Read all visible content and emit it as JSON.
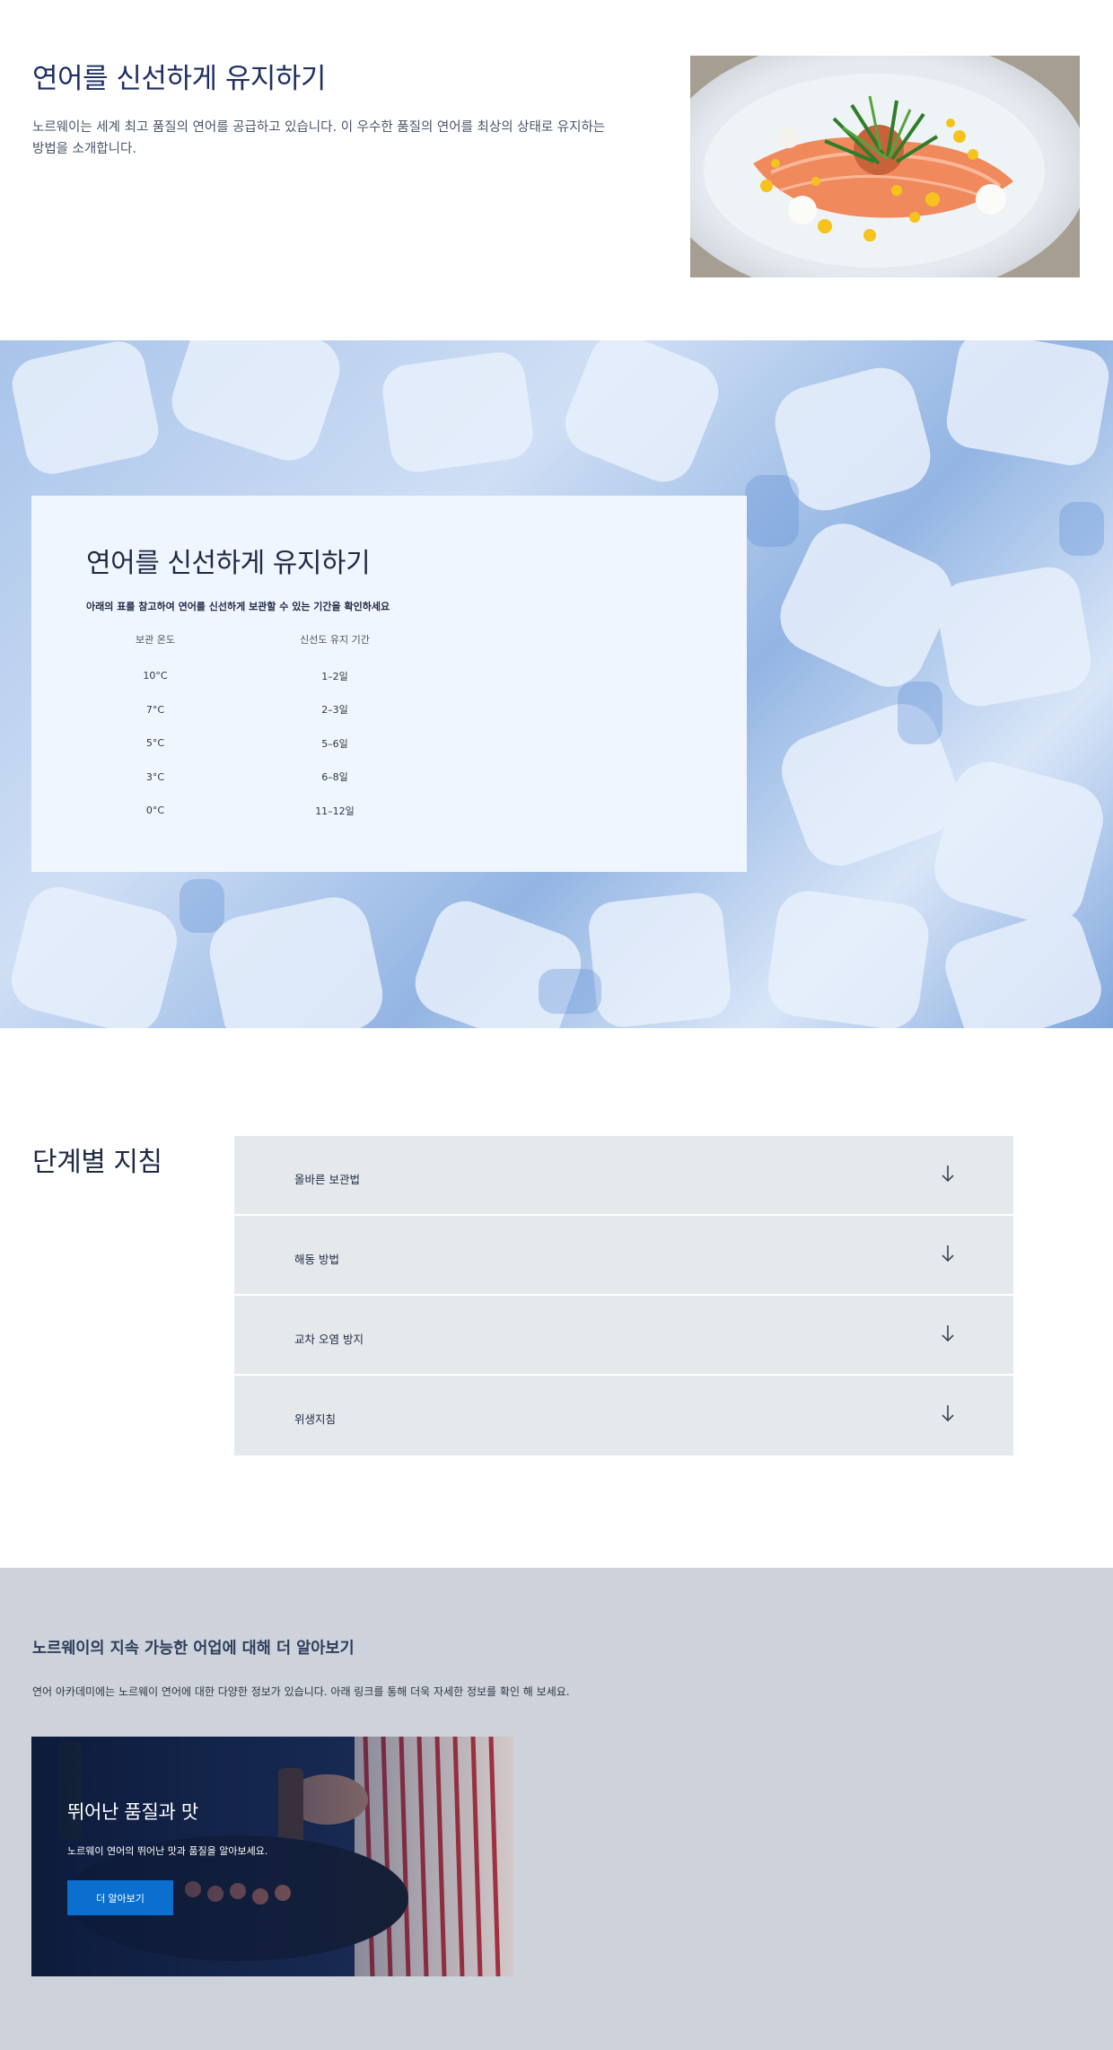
{
  "intro": {
    "title": "연어를 신선하게 유지하기",
    "text": "노르웨이는 세계 최고 품질의 연어를 공급하고 있습니다. 이 우수한 품질의 연어를 최상의 상태로 유지하는 방법을 소개합니다.",
    "image_icon": "salmon-dish-image"
  },
  "storage": {
    "title": "연어를 신선하게 유지하기",
    "description": "아래의 표를 참고하여 연어를 신선하게 보관할 수 있는 기간을 확인하세요",
    "columns": [
      "보관 온도",
      "신선도 유지 기간"
    ],
    "rows": [
      {
        "temp": "10°C",
        "period": "1–2일"
      },
      {
        "temp": "7°C",
        "period": "2–3일"
      },
      {
        "temp": "5°C",
        "period": "5–6일"
      },
      {
        "temp": "3°C",
        "period": "6–8일"
      },
      {
        "temp": "0°C",
        "period": "11–12일"
      }
    ]
  },
  "steps": {
    "title": "단계별 지침",
    "items": [
      {
        "label": "올바른 보관법",
        "icon": "arrow-down-icon"
      },
      {
        "label": "해동 방법",
        "icon": "arrow-down-icon"
      },
      {
        "label": "교차 오염 방지",
        "icon": "arrow-down-icon"
      },
      {
        "label": "위생지침",
        "icon": "arrow-down-icon"
      }
    ]
  },
  "learn": {
    "title": "노르웨이의 지속 가능한 어업에 대해 더 알아보기",
    "text": "연어 아카데미에는 노르웨이 연어에 대한 다양한 정보가 있습니다. 아래 링크를 통해 더욱 자세한 정보를 확인 해 보세요.",
    "card": {
      "title": "뛰어난 품질과 맛",
      "text": "노르웨이 연어의 뛰어난 맛과 품질을 알아보세요.",
      "button": "더 알아보기"
    }
  },
  "colors": {
    "heading_blue": "#1e2f63",
    "card_bg": "#eff6ff",
    "accordion_bg": "#e5e9ec",
    "learn_bg": "#ced2da",
    "button_blue": "#0b6fd0"
  }
}
